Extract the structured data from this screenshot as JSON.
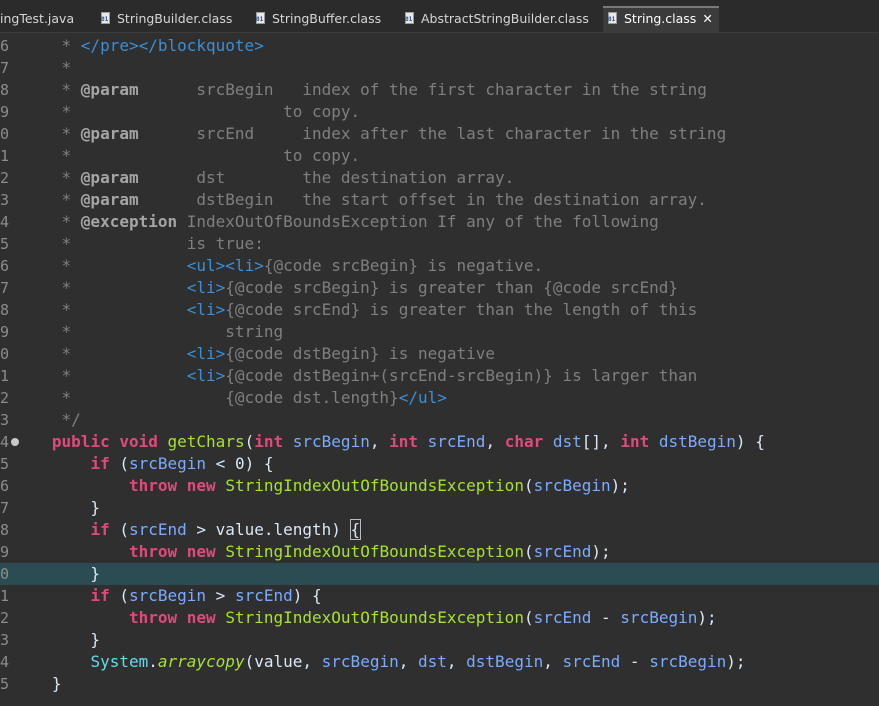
{
  "tabs": [
    {
      "label": "ingTest.java",
      "icon": "java-file-icon",
      "active": false
    },
    {
      "label": "StringBuilder.class",
      "icon": "class-file-icon",
      "active": false
    },
    {
      "label": "StringBuffer.class",
      "icon": "class-file-icon",
      "active": false
    },
    {
      "label": "AbstractStringBuilder.class",
      "icon": "class-file-icon",
      "active": false
    },
    {
      "label": "String.class",
      "icon": "class-file-icon",
      "active": true,
      "close": "✕"
    }
  ],
  "line_numbers": [
    "6",
    "7",
    "8",
    "9",
    "0",
    "1",
    "2",
    "3",
    "4",
    "5",
    "6",
    "7",
    "8",
    "9",
    "0",
    "1",
    "2",
    "3",
    "4",
    "5",
    "6",
    "7",
    "8",
    "9",
    "0",
    "1",
    "2",
    "3",
    "4",
    "5"
  ],
  "lines": [
    [
      [
        "c",
        "    * "
      ],
      [
        "ch",
        "&lt;/pre&gt;&lt;/blockquote&gt;"
      ]
    ],
    [
      [
        "c",
        "    *"
      ]
    ],
    [
      [
        "c",
        "    * "
      ],
      [
        "ct",
        "@param"
      ],
      [
        "c",
        "      srcBegin   index of the first character in the string"
      ]
    ],
    [
      [
        "c",
        "    *                      to copy."
      ]
    ],
    [
      [
        "c",
        "    * "
      ],
      [
        "ct",
        "@param"
      ],
      [
        "c",
        "      srcEnd     index after the last character in the string"
      ]
    ],
    [
      [
        "c",
        "    *                      to copy."
      ]
    ],
    [
      [
        "c",
        "    * "
      ],
      [
        "ct",
        "@param"
      ],
      [
        "c",
        "      dst        the destination array."
      ]
    ],
    [
      [
        "c",
        "    * "
      ],
      [
        "ct",
        "@param"
      ],
      [
        "c",
        "      dstBegin   the start offset in the destination array."
      ]
    ],
    [
      [
        "c",
        "    * "
      ],
      [
        "ct",
        "@exception"
      ],
      [
        "c",
        " IndexOutOfBoundsException If any of the following"
      ]
    ],
    [
      [
        "c",
        "    *            is true:"
      ]
    ],
    [
      [
        "c",
        "    *            "
      ],
      [
        "ch",
        "&lt;ul&gt;&lt;li&gt;"
      ],
      [
        "c",
        "{@code srcBegin} is negative."
      ]
    ],
    [
      [
        "c",
        "    *            "
      ],
      [
        "ch",
        "&lt;li&gt;"
      ],
      [
        "c",
        "{@code srcBegin} is greater than {@code srcEnd}"
      ]
    ],
    [
      [
        "c",
        "    *            "
      ],
      [
        "ch",
        "&lt;li&gt;"
      ],
      [
        "c",
        "{@code srcEnd} is greater than the length of this"
      ]
    ],
    [
      [
        "c",
        "    *                string"
      ]
    ],
    [
      [
        "c",
        "    *            "
      ],
      [
        "ch",
        "&lt;li&gt;"
      ],
      [
        "c",
        "{@code dstBegin} is negative"
      ]
    ],
    [
      [
        "c",
        "    *            "
      ],
      [
        "ch",
        "&lt;li&gt;"
      ],
      [
        "c",
        "{@code dstBegin+(srcEnd-srcBegin)} is larger than"
      ]
    ],
    [
      [
        "c",
        "    *                {@code dst.length}"
      ],
      [
        "ch",
        "&lt;/ul&gt;"
      ]
    ],
    [
      [
        "c",
        "    */"
      ]
    ],
    [
      [
        "pl",
        "   "
      ],
      [
        "kw",
        "public"
      ],
      [
        "pl",
        " "
      ],
      [
        "kw",
        "void"
      ],
      [
        "pl",
        " "
      ],
      [
        "fn",
        "getChars"
      ],
      [
        "pl",
        "("
      ],
      [
        "kw",
        "int"
      ],
      [
        "pl",
        " "
      ],
      [
        "pm",
        "srcBegin"
      ],
      [
        "pl",
        ", "
      ],
      [
        "kw",
        "int"
      ],
      [
        "pl",
        " "
      ],
      [
        "pm",
        "srcEnd"
      ],
      [
        "pl",
        ", "
      ],
      [
        "kw",
        "char"
      ],
      [
        "pl",
        " "
      ],
      [
        "pm",
        "dst"
      ],
      [
        "pl",
        "[], "
      ],
      [
        "kw",
        "int"
      ],
      [
        "pl",
        " "
      ],
      [
        "pm",
        "dstBegin"
      ],
      [
        "pl",
        ") {"
      ]
    ],
    [
      [
        "pl",
        "       "
      ],
      [
        "kw",
        "if"
      ],
      [
        "pl",
        " ("
      ],
      [
        "pm",
        "srcBegin"
      ],
      [
        "pl",
        " &lt; "
      ],
      [
        "num",
        "0"
      ],
      [
        "pl",
        ") {"
      ]
    ],
    [
      [
        "pl",
        "           "
      ],
      [
        "kw",
        "throw"
      ],
      [
        "pl",
        " "
      ],
      [
        "kw",
        "new"
      ],
      [
        "pl",
        " "
      ],
      [
        "cls",
        "StringIndexOutOfBoundsException"
      ],
      [
        "pl",
        "("
      ],
      [
        "pm",
        "srcBegin"
      ],
      [
        "pl",
        ");"
      ]
    ],
    [
      [
        "pl",
        "       }"
      ]
    ],
    [
      [
        "pl",
        "       "
      ],
      [
        "kw",
        "if"
      ],
      [
        "pl",
        " ("
      ],
      [
        "pm",
        "srcEnd"
      ],
      [
        "pl",
        " &gt; "
      ],
      [
        "pl",
        "value"
      ],
      [
        "pl",
        "."
      ],
      [
        "pl",
        "length"
      ],
      [
        "pl",
        ") "
      ],
      [
        "br",
        "{"
      ]
    ],
    [
      [
        "pl",
        "           "
      ],
      [
        "kw",
        "throw"
      ],
      [
        "pl",
        " "
      ],
      [
        "kw",
        "new"
      ],
      [
        "pl",
        " "
      ],
      [
        "cls",
        "StringIndexOutOfBoundsException"
      ],
      [
        "pl",
        "("
      ],
      [
        "pm",
        "srcEnd"
      ],
      [
        "pl",
        ");"
      ]
    ],
    [
      [
        "pl",
        "       }"
      ]
    ],
    [
      [
        "pl",
        "       "
      ],
      [
        "kw",
        "if"
      ],
      [
        "pl",
        " ("
      ],
      [
        "pm",
        "srcBegin"
      ],
      [
        "pl",
        " &gt; "
      ],
      [
        "pm",
        "srcEnd"
      ],
      [
        "pl",
        ") {"
      ]
    ],
    [
      [
        "pl",
        "           "
      ],
      [
        "kw",
        "throw"
      ],
      [
        "pl",
        " "
      ],
      [
        "kw",
        "new"
      ],
      [
        "pl",
        " "
      ],
      [
        "cls",
        "StringIndexOutOfBoundsException"
      ],
      [
        "pl",
        "("
      ],
      [
        "pm",
        "srcEnd"
      ],
      [
        "pl",
        " - "
      ],
      [
        "pm",
        "srcBegin"
      ],
      [
        "pl",
        ");"
      ]
    ],
    [
      [
        "pl",
        "       }"
      ]
    ],
    [
      [
        "pl",
        "       "
      ],
      [
        "sys",
        "System"
      ],
      [
        "pl",
        "."
      ],
      [
        "it",
        "arraycopy"
      ],
      [
        "pl",
        "("
      ],
      [
        "pl",
        "value"
      ],
      [
        "pl",
        ", "
      ],
      [
        "pm",
        "srcBegin"
      ],
      [
        "pl",
        ", "
      ],
      [
        "pm",
        "dst"
      ],
      [
        "pl",
        ", "
      ],
      [
        "pm",
        "dstBegin"
      ],
      [
        "pl",
        ", "
      ],
      [
        "pm",
        "srcEnd"
      ],
      [
        "pl",
        " - "
      ],
      [
        "pm",
        "srcBegin"
      ],
      [
        "pl",
        ");"
      ]
    ],
    [
      [
        "pl",
        "   }"
      ]
    ]
  ],
  "current_line_index": 24,
  "fold_line_index": 18,
  "colors": {
    "background": "#2f2f2f",
    "current_line": "#2c4c54",
    "keyword": "#e04a7b",
    "method": "#a6e22e",
    "parameter": "#79abff",
    "comment": "#7f7f7f",
    "html_tag": "#3a8fd6"
  }
}
